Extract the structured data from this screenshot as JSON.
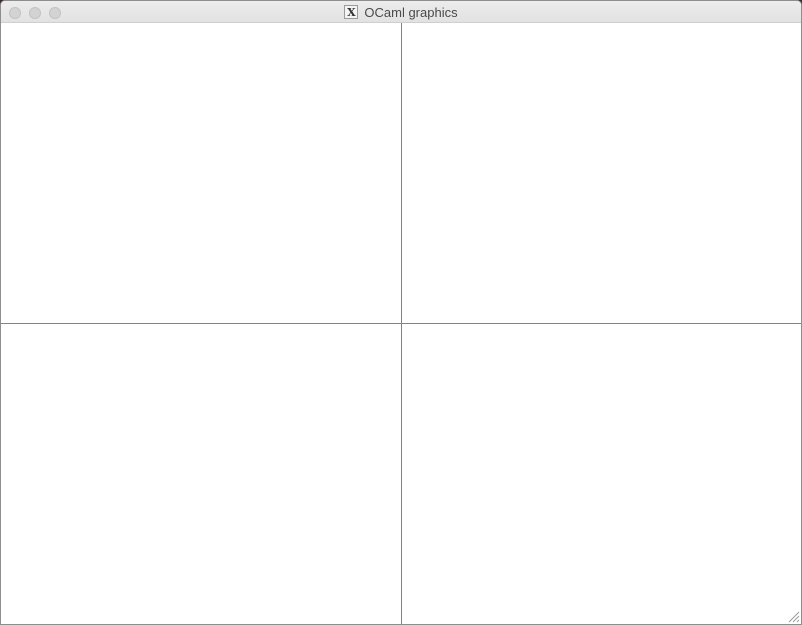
{
  "window": {
    "title": "OCaml graphics",
    "app_icon": "x11-icon"
  },
  "titlebar": {
    "buttons": [
      "close",
      "minimize",
      "zoom"
    ]
  },
  "canvas": {
    "background": "#ffffff",
    "axis_color": "#22c722"
  }
}
